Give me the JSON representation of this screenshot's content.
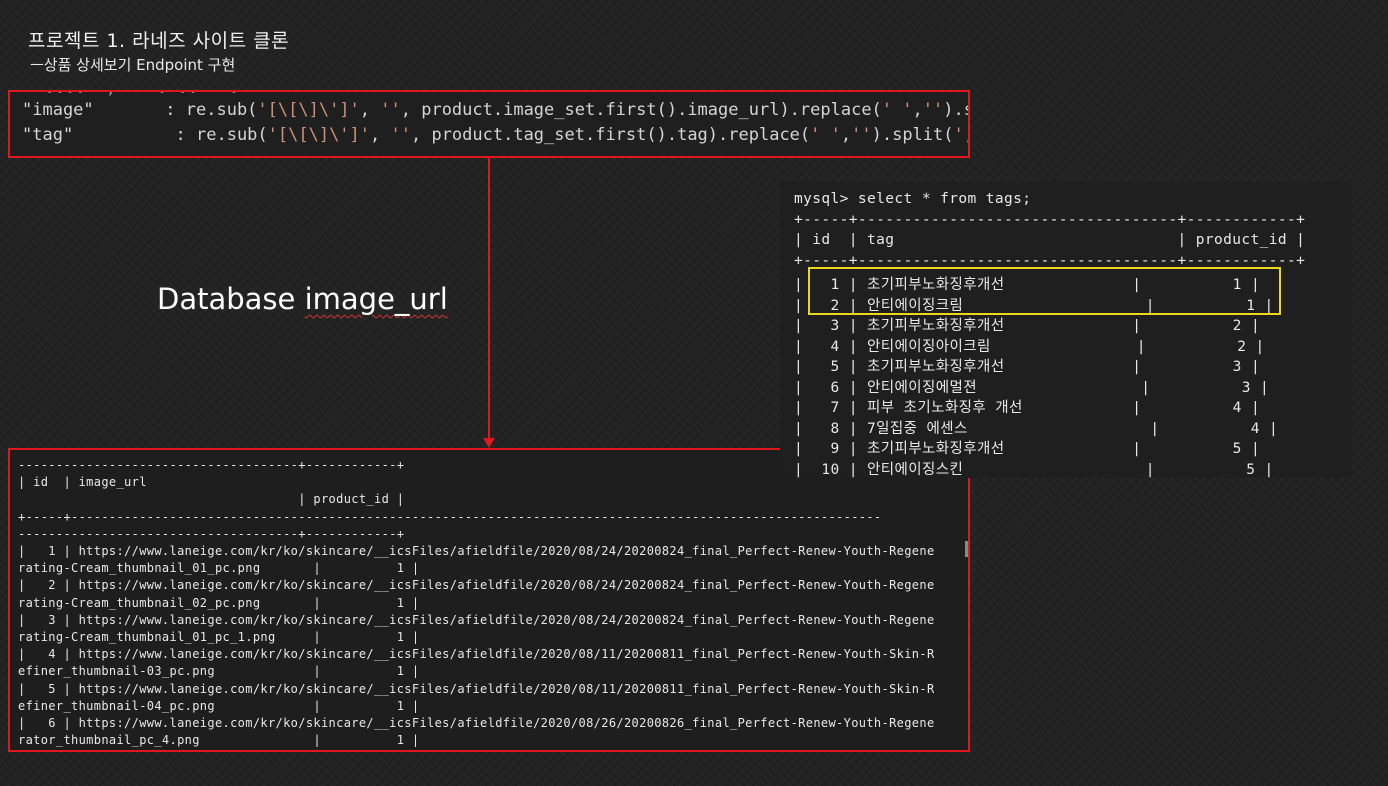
{
  "slide": {
    "title": "프로젝트 1. 라네즈 사이트 클론",
    "subtitle": "ㅡ상품 상세보기  Endpoint 구현"
  },
  "code": {
    "cut_line": "  ....  ,    . ..   .",
    "line1_key": "\"image\"",
    "line1_rest_a": "       : re.sub(",
    "line1_str1": "'[\\[\\]\\']'",
    "line1_rest_b": ", ",
    "line1_str2": "''",
    "line1_rest_c": ", product.image_set.first().image_url).replace(",
    "line1_str3": "' '",
    "line1_rest_d": ",",
    "line1_str4": "''",
    "line1_rest_e": ").split(",
    "line1_str5": "','",
    "line1_rest_f": "),",
    "line2_key": "\"tag\"",
    "line2_rest_a": "          : re.sub(",
    "line2_str1": "'[\\[\\]\\']'",
    "line2_rest_b": ", ",
    "line2_str2": "''",
    "line2_rest_c": ", product.tag_set.first().tag).replace(",
    "line2_str3": "' '",
    "line2_rest_d": ",",
    "line2_str4": "''",
    "line2_rest_e": ").split(",
    "line2_str5": "','",
    "line2_rest_f": ")"
  },
  "db_label": {
    "prefix": "Database ",
    "underlined": "image_url"
  },
  "image_table": {
    "lines": [
      "-------------------------------------+------------+",
      "| id  | image_url",
      "                                     | product_id |",
      "+-----+-----------------------------------------------------------------------------------------------------------",
      "-------------------------------------+------------+",
      "|   1 | https://www.laneige.com/kr/ko/skincare/__icsFiles/afieldfile/2020/08/24/20200824_final_Perfect-Renew-Youth-Regene",
      "rating-Cream_thumbnail_01_pc.png       |          1 |",
      "|   2 | https://www.laneige.com/kr/ko/skincare/__icsFiles/afieldfile/2020/08/24/20200824_final_Perfect-Renew-Youth-Regene",
      "rating-Cream_thumbnail_02_pc.png       |          1 |",
      "|   3 | https://www.laneige.com/kr/ko/skincare/__icsFiles/afieldfile/2020/08/24/20200824_final_Perfect-Renew-Youth-Regene",
      "rating-Cream_thumbnail_01_pc_1.png     |          1 |",
      "|   4 | https://www.laneige.com/kr/ko/skincare/__icsFiles/afieldfile/2020/08/11/20200811_final_Perfect-Renew-Youth-Skin-R",
      "efiner_thumbnail-03_pc.png             |          1 |",
      "|   5 | https://www.laneige.com/kr/ko/skincare/__icsFiles/afieldfile/2020/08/11/20200811_final_Perfect-Renew-Youth-Skin-R",
      "efiner_thumbnail-04_pc.png             |          1 |",
      "|   6 | https://www.laneige.com/kr/ko/skincare/__icsFiles/afieldfile/2020/08/26/20200826_final_Perfect-Renew-Youth-Regene",
      "rator_thumbnail_pc_4.png               |          1 |"
    ]
  },
  "tags_terminal": {
    "lines": [
      "mysql> select * from tags;",
      "+-----+-----------------------------------+------------+",
      "| id  | tag                               | product_id |",
      "+-----+-----------------------------------+------------+",
      "|   1 | 초기피부노화징후개선              |          1 |",
      "|   2 | 안티에이징크림                    |          1 |",
      "|   3 | 초기피부노화징후개선              |          2 |",
      "|   4 | 안티에이징아이크림                |          2 |",
      "|   5 | 초기피부노화징후개선              |          3 |",
      "|   6 | 안티에이징에멀젼                  |          3 |",
      "|   7 | 피부 초기노화징후 개선            |          4 |",
      "|   8 | 7일집중 에센스                    |          4 |",
      "|   9 | 초기피부노화징후개선              |          5 |",
      "|  10 | 안티에이징스킨                    |          5 |"
    ]
  },
  "colors": {
    "annotation_red": "#e0181e",
    "highlight_yellow": "#ecd71d",
    "string_literal": "#ce9178"
  }
}
